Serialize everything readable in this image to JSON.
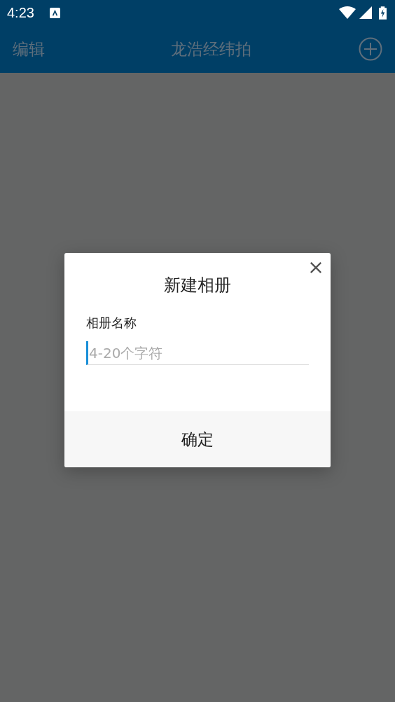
{
  "status_bar": {
    "time": "4:23"
  },
  "header": {
    "left_action": "编辑",
    "title": "龙浩经纬拍"
  },
  "dialog": {
    "title": "新建相册",
    "field_label": "相册名称",
    "field": {
      "placeholder": "4-20个字符",
      "focused": true
    },
    "confirm_button": "确定"
  }
}
